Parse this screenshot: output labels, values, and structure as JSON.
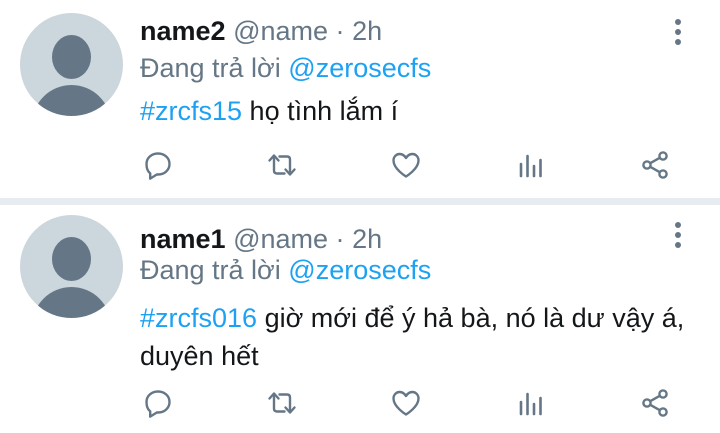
{
  "colors": {
    "accent": "#1da1f2",
    "secondary_text": "#657786",
    "primary_text": "#14171a",
    "avatar_bg": "#ccd6dd",
    "divider": "#e6ecf0"
  },
  "tweets": [
    {
      "name": "name2",
      "handle": "@name",
      "separator": "·",
      "time": "2h",
      "reply_prefix": "Đang trả lời",
      "reply_mention": "@zerosecfs",
      "hashtag": "#zrcfs15",
      "text": " họ tình lắm í",
      "actions": [
        "reply-icon",
        "retweet-icon",
        "like-icon",
        "stats-icon",
        "share-icon"
      ]
    },
    {
      "name": "name1",
      "handle": "@name",
      "separator": "·",
      "time": "2h",
      "reply_prefix": "Đang trả lời",
      "reply_mention": "@zerosecfs",
      "hashtag": "#zrcfs016",
      "text": " giờ mới để ý hả bà, nó là dư vậy á, duyên hết",
      "actions": [
        "reply-icon",
        "retweet-icon",
        "like-icon",
        "stats-icon",
        "share-icon"
      ]
    }
  ]
}
